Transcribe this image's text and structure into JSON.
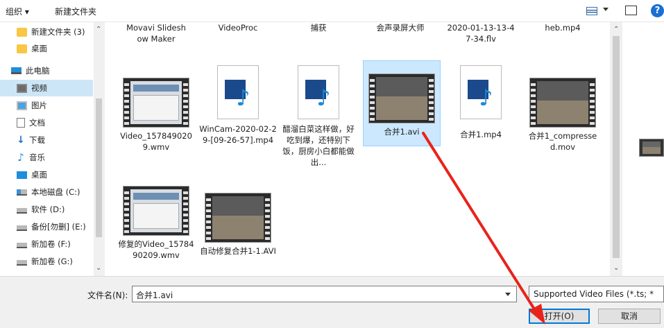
{
  "toolbar": {
    "organize_label": "组织 ▾",
    "new_folder_label": "新建文件夹"
  },
  "nav": {
    "items": [
      {
        "label": "新建文件夹 (3)",
        "icon": "folder-icon"
      },
      {
        "label": "桌面",
        "icon": "folder-icon"
      },
      {
        "label": "此电脑",
        "icon": "computer-icon"
      },
      {
        "label": "视频",
        "icon": "video-icon"
      },
      {
        "label": "图片",
        "icon": "picture-icon"
      },
      {
        "label": "文档",
        "icon": "document-icon"
      },
      {
        "label": "下载",
        "icon": "download-icon"
      },
      {
        "label": "音乐",
        "icon": "music-icon"
      },
      {
        "label": "桌面",
        "icon": "desktop-icon"
      },
      {
        "label": "本地磁盘 (C:)",
        "icon": "os-drive-icon"
      },
      {
        "label": "软件 (D:)",
        "icon": "drive-icon"
      },
      {
        "label": "备份[勿删] (E:)",
        "icon": "drive-icon"
      },
      {
        "label": "新加卷 (F:)",
        "icon": "drive-icon"
      },
      {
        "label": "新加卷 (G:)",
        "icon": "drive-icon"
      }
    ],
    "selected_index": 3
  },
  "files": {
    "top_row": [
      {
        "name": "Movavi Slideshow Maker"
      },
      {
        "name": "VideoProc"
      },
      {
        "name": "捕获"
      },
      {
        "name": "会声录屏大师"
      },
      {
        "name": "2020-01-13-13-47-34.flv"
      },
      {
        "name": "heb.mp4"
      }
    ],
    "row2": [
      {
        "name": "Video_1578490209.wmv",
        "kind": "video-screen"
      },
      {
        "name": "WinCam-2020-02-29-[09-26-57].mp4",
        "kind": "media-doc"
      },
      {
        "name": "醋溜白菜这样做，好吃到爆，还特别下饭，厨房小白都能做出...",
        "kind": "media-doc"
      },
      {
        "name": "合并1.avi",
        "kind": "video-dark"
      },
      {
        "name": "合并1.mp4",
        "kind": "media-doc"
      },
      {
        "name": "合并1_compressed.mov",
        "kind": "video-dark"
      }
    ],
    "row3": [
      {
        "name": "修复的Video_1578490209.wmv",
        "kind": "video-screen"
      },
      {
        "name": "自动修复合并1-1.AVI",
        "kind": "video-dark"
      }
    ],
    "selected_name": "合并1.avi"
  },
  "bottom": {
    "filename_label": "文件名(N):",
    "filename_value": "合并1.avi",
    "filetype_value": "Supported Video Files (*.ts; *",
    "open_label": "打开(O)",
    "cancel_label": "取消"
  },
  "colors": {
    "selection_bg": "#cce8ff",
    "nav_selection_bg": "#cde6f7",
    "annotation_arrow": "#e8231b",
    "accent": "#0078d7"
  }
}
